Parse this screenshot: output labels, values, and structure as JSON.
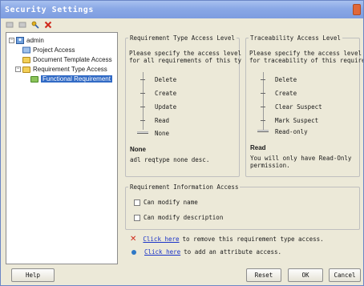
{
  "window": {
    "title": "Security Settings"
  },
  "toolbar": {
    "icons": [
      "back-icon",
      "forward-icon",
      "key-icon",
      "delete-icon"
    ]
  },
  "tree": {
    "root": "admin",
    "items": [
      {
        "label": "Project Access"
      },
      {
        "label": "Document Template Access"
      },
      {
        "label": "Requirement Type Access"
      },
      {
        "label": "Functional Requirement"
      }
    ]
  },
  "req_type_access": {
    "legend": "Requirement Type Access Level",
    "description": "Please specify the access level\nfor all requirements of this ty",
    "levels": [
      "Delete",
      "Create",
      "Update",
      "Read",
      "None"
    ],
    "selected": "None",
    "selected_name": "None",
    "selected_desc": "adl reqtype none desc."
  },
  "trace_access": {
    "legend": "Traceability Access Level",
    "description": "Please specify the access level\nfor traceability of this requirem",
    "levels": [
      "Delete",
      "Create",
      "Clear Suspect",
      "Mark Suspect",
      "Read-only"
    ],
    "selected": "Read-only",
    "selected_name": "Read",
    "selected_desc": "You will only have Read-Only\npermission."
  },
  "info_access": {
    "legend": "Requirement Information Access",
    "can_modify_name": "Can modify name",
    "can_modify_description": "Can modify description"
  },
  "actions": {
    "remove_link": "Click here",
    "remove_text": "to remove this requirement type access.",
    "add_link": "Click here",
    "add_text": "to add an attribute access."
  },
  "buttons": {
    "help": "Help",
    "reset": "Reset",
    "ok": "OK",
    "cancel": "Cancel"
  },
  "colors": {
    "titlebar": "#8aa8e6",
    "selection": "#316ac5",
    "link": "#1a33c8",
    "delete_icon": "#d02a1c"
  }
}
